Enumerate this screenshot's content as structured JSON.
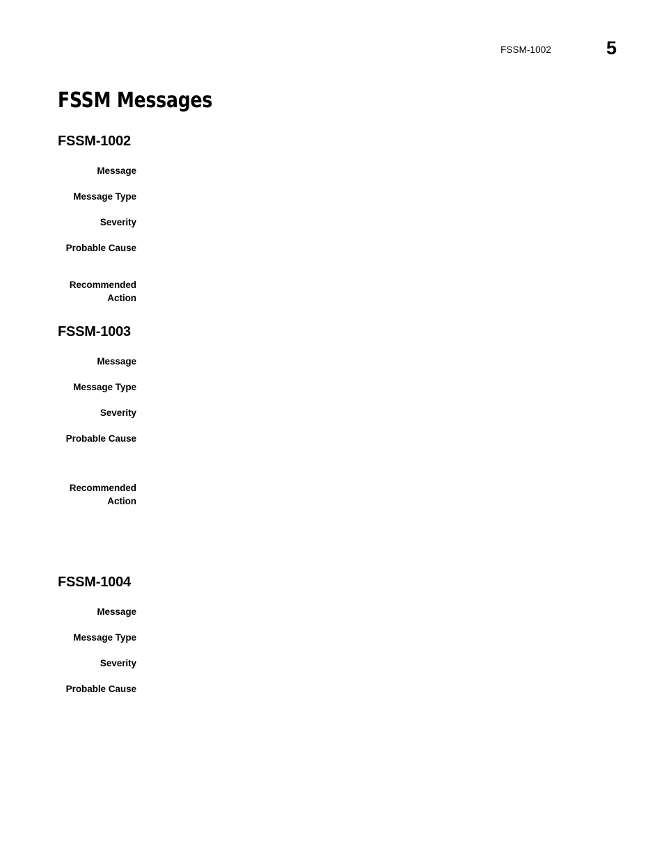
{
  "header": {
    "chapter_label": "FSSM-1002",
    "page_number": "5"
  },
  "document": {
    "title": "FSSM Messages"
  },
  "field_labels": {
    "message": "Message",
    "message_type": "Message Type",
    "severity": "Severity",
    "probable_cause": "Probable Cause",
    "recommended_action": "Recommended\nAction"
  },
  "sections": [
    {
      "heading": "FSSM-1002",
      "fields": [
        {
          "label": "Message",
          "value": ""
        },
        {
          "label": "Message Type",
          "value": ""
        },
        {
          "label": "Severity",
          "value": ""
        },
        {
          "label": "Probable Cause",
          "value": ""
        },
        {
          "label": "Recommended\nAction",
          "value": ""
        }
      ]
    },
    {
      "heading": "FSSM-1003",
      "fields": [
        {
          "label": "Message",
          "value": ""
        },
        {
          "label": "Message Type",
          "value": ""
        },
        {
          "label": "Severity",
          "value": ""
        },
        {
          "label": "Probable Cause",
          "value": ""
        },
        {
          "label": "Recommended\nAction",
          "value": ""
        }
      ]
    },
    {
      "heading": "FSSM-1004",
      "fields": [
        {
          "label": "Message",
          "value": ""
        },
        {
          "label": "Message Type",
          "value": ""
        },
        {
          "label": "Severity",
          "value": ""
        },
        {
          "label": "Probable Cause",
          "value": ""
        }
      ]
    }
  ]
}
